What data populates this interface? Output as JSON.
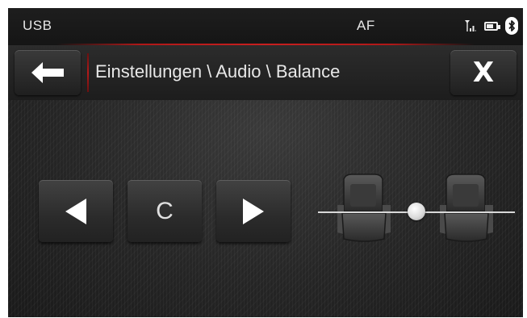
{
  "status": {
    "source": "USB",
    "af": "AF",
    "icons": [
      "signal-icon",
      "battery-icon",
      "bluetooth-icon"
    ]
  },
  "header": {
    "breadcrumb": "Einstellungen \\ Audio \\ Balance",
    "back_icon": "arrow-left-icon",
    "close_label": "X"
  },
  "balance": {
    "decrease_icon": "triangle-left-icon",
    "center_label": "C",
    "increase_icon": "triangle-right-icon",
    "value": 0,
    "value_label": "C"
  },
  "colors": {
    "accent_red": "#c81f1f",
    "background": "#262626",
    "text": "#e8e8e8"
  }
}
